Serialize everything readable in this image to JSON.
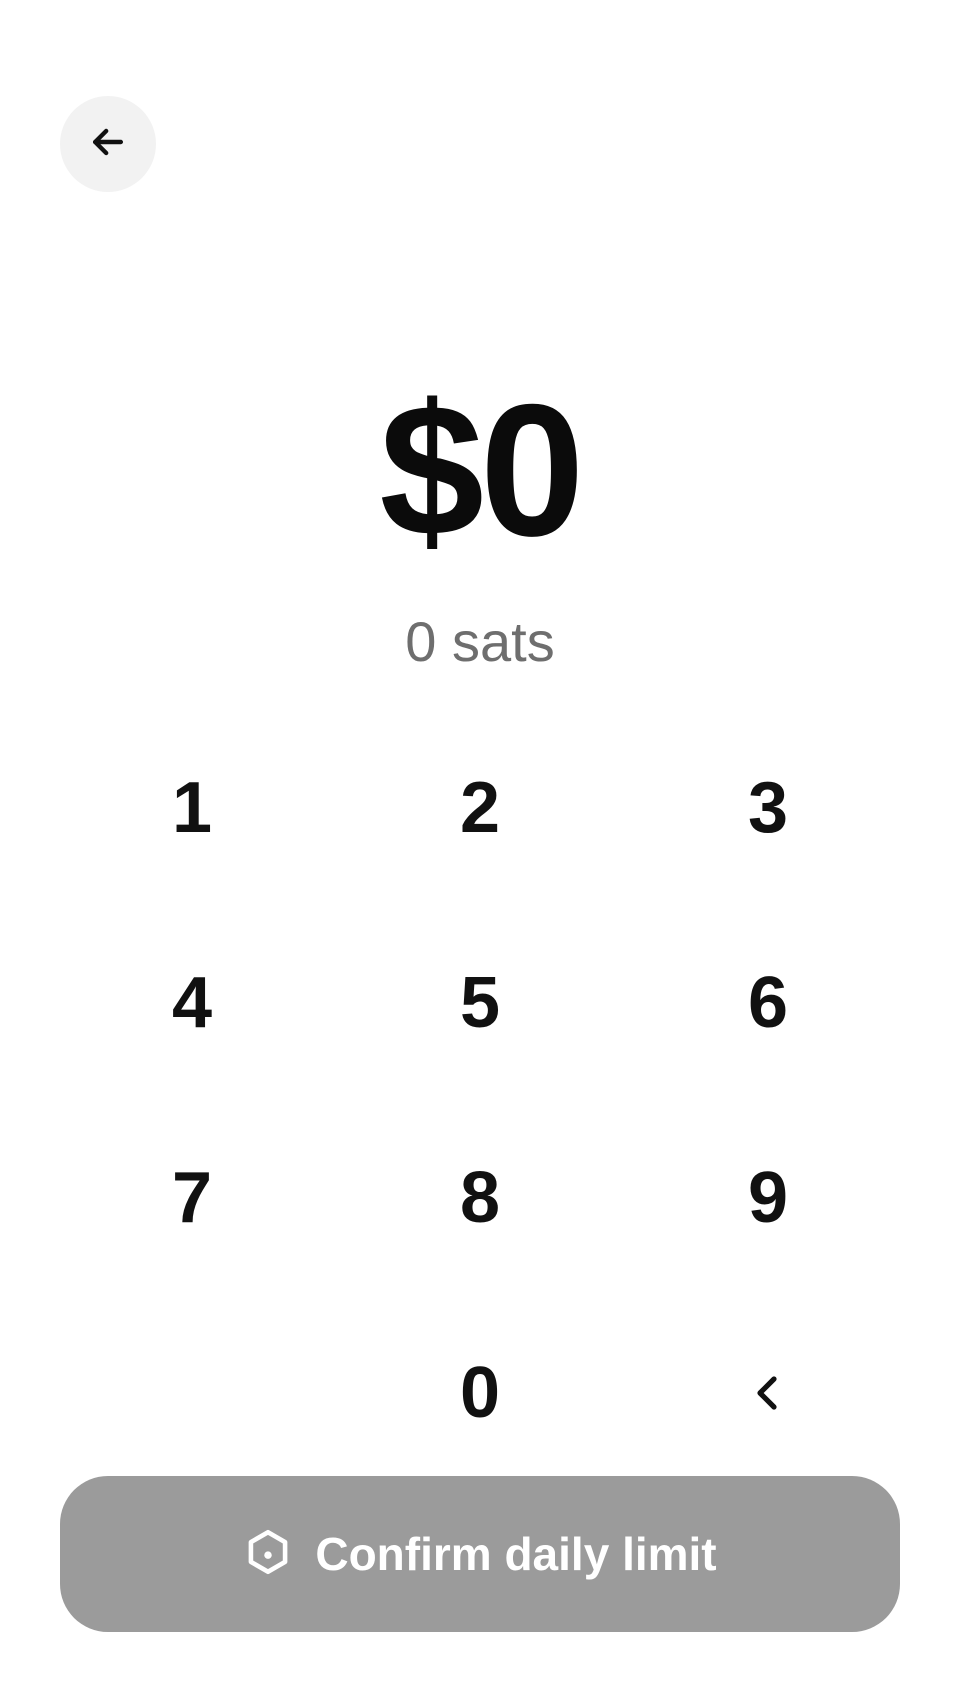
{
  "header": {
    "back_icon": "arrow-left-icon"
  },
  "amount": {
    "fiat": "$0",
    "sats": "0 sats"
  },
  "keypad": {
    "keys": [
      "1",
      "2",
      "3",
      "4",
      "5",
      "6",
      "7",
      "8",
      "9",
      "0"
    ],
    "backspace_icon": "chevron-left-icon"
  },
  "confirm": {
    "label": "Confirm daily limit",
    "icon": "hexagon-lock-icon",
    "background": "#9b9b9b",
    "text_color": "#ffffff",
    "state": "disabled"
  }
}
